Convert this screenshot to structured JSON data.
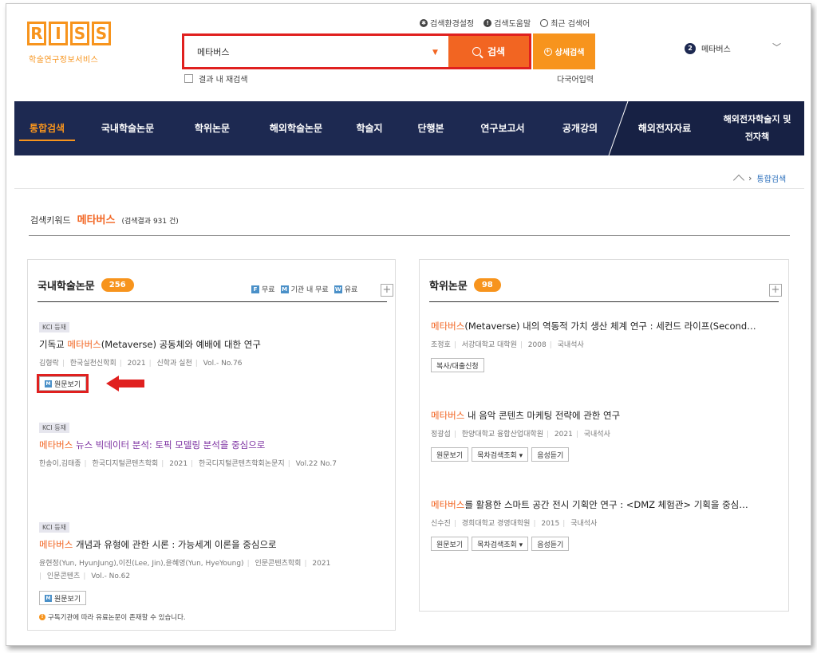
{
  "logo": {
    "letters": [
      "R",
      "I",
      "S",
      "S"
    ],
    "subtitle": "학술연구정보서비스"
  },
  "toplinks": [
    {
      "label": "검색환경설정",
      "icon": "gear-icon"
    },
    {
      "label": "검색도움말",
      "icon": "info-icon"
    },
    {
      "label": "최근 검색어",
      "icon": "clock-icon"
    }
  ],
  "search": {
    "value": "메타버스",
    "button": "검색",
    "advanced": "상세검색",
    "re_search": "결과 내 재검색",
    "multilang": "다국어입력"
  },
  "user": {
    "badge": "2",
    "label": "메타버스"
  },
  "nav": {
    "items": [
      "통합검색",
      "국내학술논문",
      "학위논문",
      "해외학술논문",
      "학술지",
      "단행본",
      "연구보고서",
      "공개강의"
    ],
    "right1": "해외전자자료",
    "right2a": "해외전자학술지 및",
    "right2b": "전자책"
  },
  "breadcrumb": {
    "current": "통합검색"
  },
  "keyword": {
    "label": "검색키워드",
    "term": "메타버스",
    "count": "(검색결과 931 건)"
  },
  "left_panel": {
    "title": "국내학술논문",
    "count": "256",
    "legend": [
      "무료",
      "기관 내 무료",
      "유료"
    ],
    "items": [
      {
        "tag": "KCI 등재",
        "title_pre": "기독교 ",
        "title_hl": "메타버스",
        "title_post": "(Metaverse) 공동체와 예배에 대한 연구",
        "meta": [
          "김형락",
          "한국실천신학회",
          "2021",
          "신학과 실천",
          "Vol.- No.76"
        ],
        "button": "원문보기"
      },
      {
        "tag": "KCI 등재",
        "title_pre": "",
        "title_hl": "메타버스",
        "title_post": " 뉴스 빅데이터 분석: 토픽 모델링 분석을 중심으로",
        "meta": [
          "한송이,김태종",
          "한국디지털콘텐츠학회",
          "2021",
          "한국디지털콘텐츠학회논문지",
          "Vol.22 No.7"
        ]
      },
      {
        "tag": "KCI 등재",
        "title_pre": "",
        "title_hl": "메타버스",
        "title_post": " 개념과 유형에 관한 시론 : 가능세계 이론을 중심으로",
        "meta1": [
          "윤현정(Yun, HyunJung),이진(Lee, Jin),윤혜영(Yun, HyeYoung)",
          "인문콘텐츠학회",
          "2021"
        ],
        "meta2": [
          "인문콘텐츠",
          "Vol.- No.62"
        ],
        "button": "원문보기"
      }
    ],
    "note": "구독기관에 따라 유료논문이 존재할 수 있습니다."
  },
  "right_panel": {
    "title": "학위논문",
    "count": "98",
    "items": [
      {
        "title_hl": "메타버스",
        "title_post": "(Metaverse) 내의 역동적 가치 생산 체계 연구 : 세컨드 라이프(Second…",
        "meta": [
          "조정호",
          "서강대학교 대학원",
          "2008",
          "국내석사"
        ],
        "buttons": [
          "복사/대출신청"
        ]
      },
      {
        "title_hl": "메타버스",
        "title_post": " 내 음악 콘텐츠 마케팅 전략에 관한 연구",
        "meta": [
          "정광섭",
          "한양대학교 융합산업대학원",
          "2021",
          "국내석사"
        ],
        "buttons": [
          "원문보기",
          "목차검색조회 ▾",
          "음성듣기"
        ]
      },
      {
        "title_hl": "메타버스",
        "title_post": "를 활용한 스마트 공간 전시 기획안 연구 : <DMZ 체험관> 기획을 중심…",
        "meta": [
          "신수진",
          "경희대학교 경영대학원",
          "2015",
          "국내석사"
        ],
        "buttons": [
          "원문보기",
          "목차검색조회 ▾",
          "음성듣기"
        ]
      }
    ]
  },
  "colors": {
    "accent": "#f26522",
    "logo": "#f7941d",
    "nav": "#1d2951",
    "annotation": "#e0201f"
  }
}
